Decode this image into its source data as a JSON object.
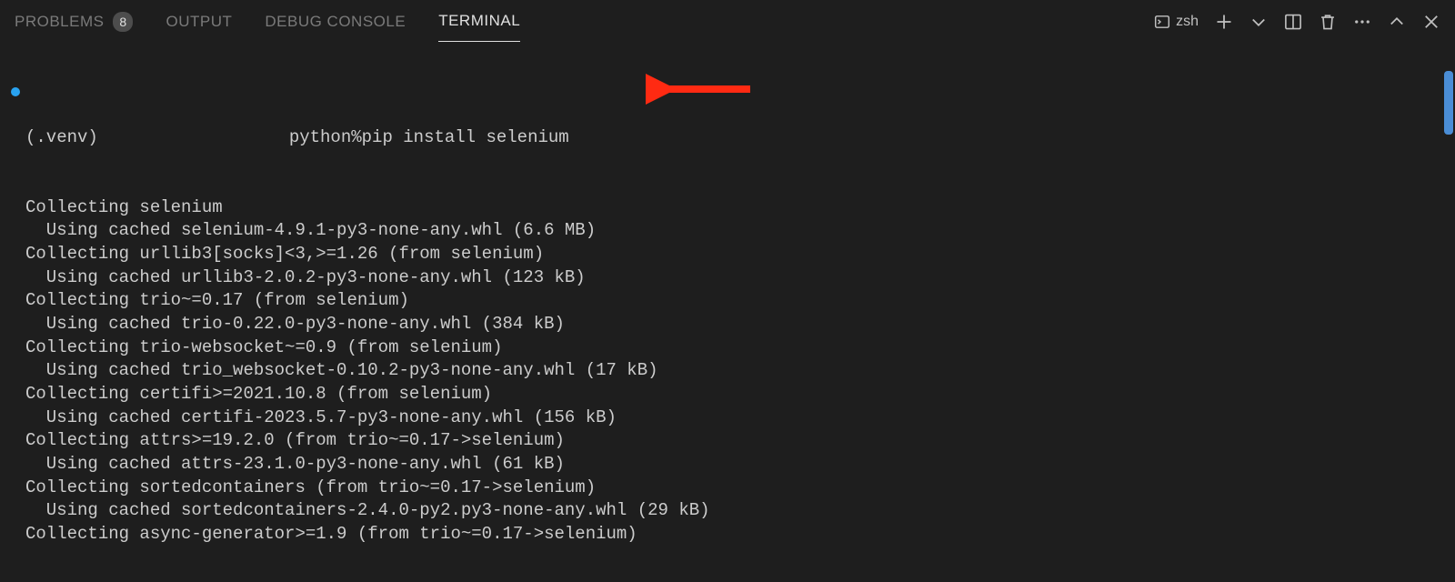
{
  "tabs": {
    "problems": {
      "label": "PROBLEMS",
      "badge": "8"
    },
    "output": {
      "label": "OUTPUT"
    },
    "debug": {
      "label": "DEBUG CONSOLE"
    },
    "terminal": {
      "label": "TERMINAL"
    }
  },
  "toolbar": {
    "shell": "zsh"
  },
  "terminal": {
    "venv": "(.venv)",
    "cwd": "python",
    "sep": "%",
    "cmd": "pip install selenium",
    "lines": [
      "Collecting selenium",
      "  Using cached selenium-4.9.1-py3-none-any.whl (6.6 MB)",
      "Collecting urllib3[socks]<3,>=1.26 (from selenium)",
      "  Using cached urllib3-2.0.2-py3-none-any.whl (123 kB)",
      "Collecting trio~=0.17 (from selenium)",
      "  Using cached trio-0.22.0-py3-none-any.whl (384 kB)",
      "Collecting trio-websocket~=0.9 (from selenium)",
      "  Using cached trio_websocket-0.10.2-py3-none-any.whl (17 kB)",
      "Collecting certifi>=2021.10.8 (from selenium)",
      "  Using cached certifi-2023.5.7-py3-none-any.whl (156 kB)",
      "Collecting attrs>=19.2.0 (from trio~=0.17->selenium)",
      "  Using cached attrs-23.1.0-py3-none-any.whl (61 kB)",
      "Collecting sortedcontainers (from trio~=0.17->selenium)",
      "  Using cached sortedcontainers-2.4.0-py2.py3-none-any.whl (29 kB)",
      "Collecting async-generator>=1.9 (from trio~=0.17->selenium)"
    ]
  }
}
